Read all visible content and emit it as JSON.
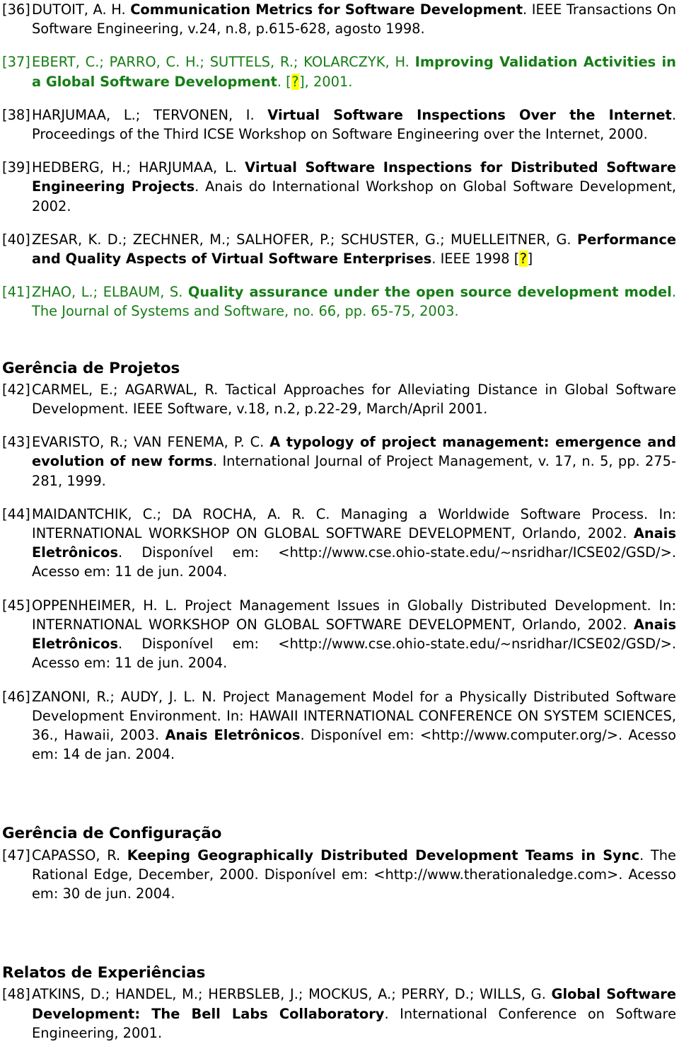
{
  "document": {
    "language": "pt-BR",
    "accent_green": "#167d16",
    "highlight_yellow": "#ffff00",
    "text_black": "#000000"
  },
  "references": [
    {
      "id": "ref-36",
      "number": "[36]",
      "color": "black",
      "authors": "DUTOIT, A. H. ",
      "title": "Communication Metrics for Software Development",
      "rest": ". IEEE Transactions On Software Engineering, v.24, n.8, p.615-628, agosto 1998."
    },
    {
      "id": "ref-37",
      "number": "[37]",
      "color": "green",
      "authors": "EBERT, C.; PARRO, C. H.; SUTTELS, R.; KOLARCZYK, H. ",
      "title": "Improving Validation Activities in a Global Software Development",
      "rest_before_marker": ". [",
      "marker": "?",
      "rest_after_marker": "], 2001."
    },
    {
      "id": "ref-38",
      "number": "[38]",
      "color": "black",
      "authors": "HARJUMAA, L.; TERVONEN, I. ",
      "title": "Virtual Software Inspections Over the Internet",
      "rest": ". Proceedings of the Third ICSE Workshop on Software Engineering over the Internet, 2000."
    },
    {
      "id": "ref-39",
      "number": "[39]",
      "color": "black",
      "authors": "HEDBERG, H.; HARJUMAA, L. ",
      "title": "Virtual Software Inspections for Distributed Software Engineering Projects",
      "rest": ". Anais do International Workshop on Global Software Development, 2002."
    },
    {
      "id": "ref-40",
      "number": "[40]",
      "color": "black",
      "authors": "ZESAR, K. D.; ZECHNER, M.; SALHOFER, P.; SCHUSTER, G.; MUELLEITNER, G. ",
      "title": "Performance and Quality Aspects of Virtual Software Enterprises",
      "rest_before_marker": ". IEEE 1998 [",
      "marker": "?",
      "rest_after_marker": "]"
    },
    {
      "id": "ref-41",
      "number": "[41]",
      "color": "green",
      "authors": "ZHAO, L.; ELBAUM, S. ",
      "title": "Quality assurance under the open source development model",
      "rest": ". The Journal of Systems and Software, no. 66, pp. 65-75, 2003."
    }
  ],
  "sections": [
    {
      "id": "section-gerencia-projetos",
      "heading": "Gerência de Projetos",
      "references": [
        {
          "id": "ref-42",
          "number": "[42]",
          "color": "black",
          "authors": "CARMEL, E.; AGARWAL, R. ",
          "plain": "Tactical Approaches for Alleviating Distance in Global Software Development. IEEE Software, v.18, n.2, p.22-29, March/April 2001."
        },
        {
          "id": "ref-43",
          "number": "[43]",
          "color": "black",
          "authors": "EVARISTO, R.; VAN FENEMA, P. C. ",
          "title": "A typology of project management: emergence and evolution of new forms",
          "rest": ". International Journal of Project Management, v. 17, n. 5, pp. 275-281, 1999."
        },
        {
          "id": "ref-44",
          "number": "[44]",
          "color": "black",
          "authors": "MAIDANTCHIK, C.; DA ROCHA, A. R. C. ",
          "plain_1": "Managing a Worldwide Software Process. In: INTERNATIONAL WORKSHOP ON GLOBAL SOFTWARE DEVELOPMENT, Orlando, 2002. ",
          "title": "Anais Eletrônicos",
          "rest": ". Disponível em: <http://www.cse.ohio-state.edu/~nsridhar/ICSE02/GSD/>. Acesso em: 11 de jun. 2004."
        },
        {
          "id": "ref-45",
          "number": "[45]",
          "color": "black",
          "authors": "OPPENHEIMER, H. L. ",
          "plain_1": "Project Management Issues in Globally Distributed Development. In: INTERNATIONAL WORKSHOP ON GLOBAL SOFTWARE DEVELOPMENT, Orlando, 2002. ",
          "title": "Anais Eletrônicos",
          "rest": ". Disponível em: <http://www.cse.ohio-state.edu/~nsridhar/ICSE02/GSD/>. Acesso em: 11 de jun. 2004."
        },
        {
          "id": "ref-46",
          "number": "[46]",
          "color": "black",
          "authors": "ZANONI, R.; AUDY, J. L. N. ",
          "plain_1": "Project Management Model for a Physically Distributed Software Development Environment. In: HAWAII INTERNATIONAL CONFERENCE ON SYSTEM SCIENCES, 36., Hawaii, 2003. ",
          "title": "Anais Eletrônicos",
          "rest": ". Disponível em: <http://www.computer.org/>. Acesso em: 14 de jan. 2004."
        }
      ]
    },
    {
      "id": "section-gerencia-configuracao",
      "heading": "Gerência de Configuração",
      "references": [
        {
          "id": "ref-47",
          "number": "[47]",
          "color": "black",
          "authors": "CAPASSO, R. ",
          "title": "Keeping Geographically Distributed Development Teams in Sync",
          "rest": ". The Rational Edge, December, 2000. Disponível em: <http://www.therationaledge.com>. Acesso em: 30 de jun. 2004."
        }
      ]
    },
    {
      "id": "section-relatos-experiencias",
      "heading": "Relatos de Experiências",
      "references": [
        {
          "id": "ref-48",
          "number": "[48]",
          "color": "black",
          "authors": "ATKINS, D.; HANDEL, M.; HERBSLEB, J.; MOCKUS, A.; PERRY, D.; WILLS, G. ",
          "title": "Global Software Development: The Bell Labs Collaboratory",
          "rest": ". International Conference on Software Engineering, 2001."
        }
      ]
    }
  ]
}
